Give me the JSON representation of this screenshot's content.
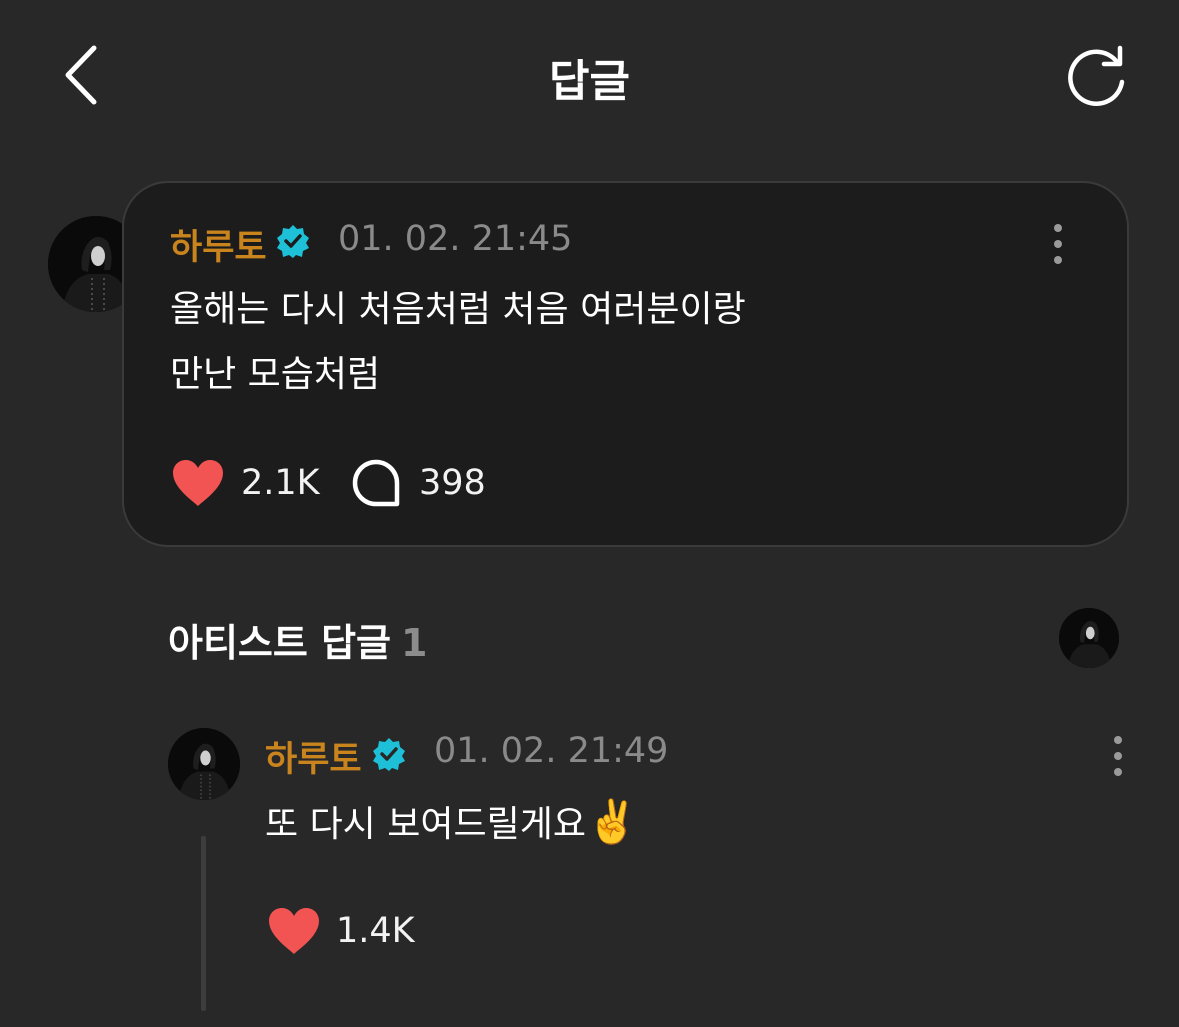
{
  "header": {
    "title": "답글",
    "back_icon": "chevron-left-icon",
    "refresh_icon": "refresh-icon"
  },
  "post": {
    "author": "하루토",
    "timestamp": "01. 02. 21:45",
    "text_line1": "올해는 다시 처음처럼 처음 여러분이랑",
    "text_line2": "만난 모습처럼",
    "likes": "2.1K",
    "comments": "398"
  },
  "artist_replies": {
    "label": "아티스트 답글",
    "count": "1"
  },
  "reply": {
    "author": "하루토",
    "timestamp": "01. 02. 21:49",
    "text": "또 다시 보여드릴게요",
    "emoji": "✌️",
    "likes": "1.4K"
  },
  "colors": {
    "background": "#282828",
    "card": "#1c1c1c",
    "author": "#c9841e",
    "verified": "#1ec0d8",
    "heart": "#f25454",
    "muted": "#8a8a8a"
  }
}
